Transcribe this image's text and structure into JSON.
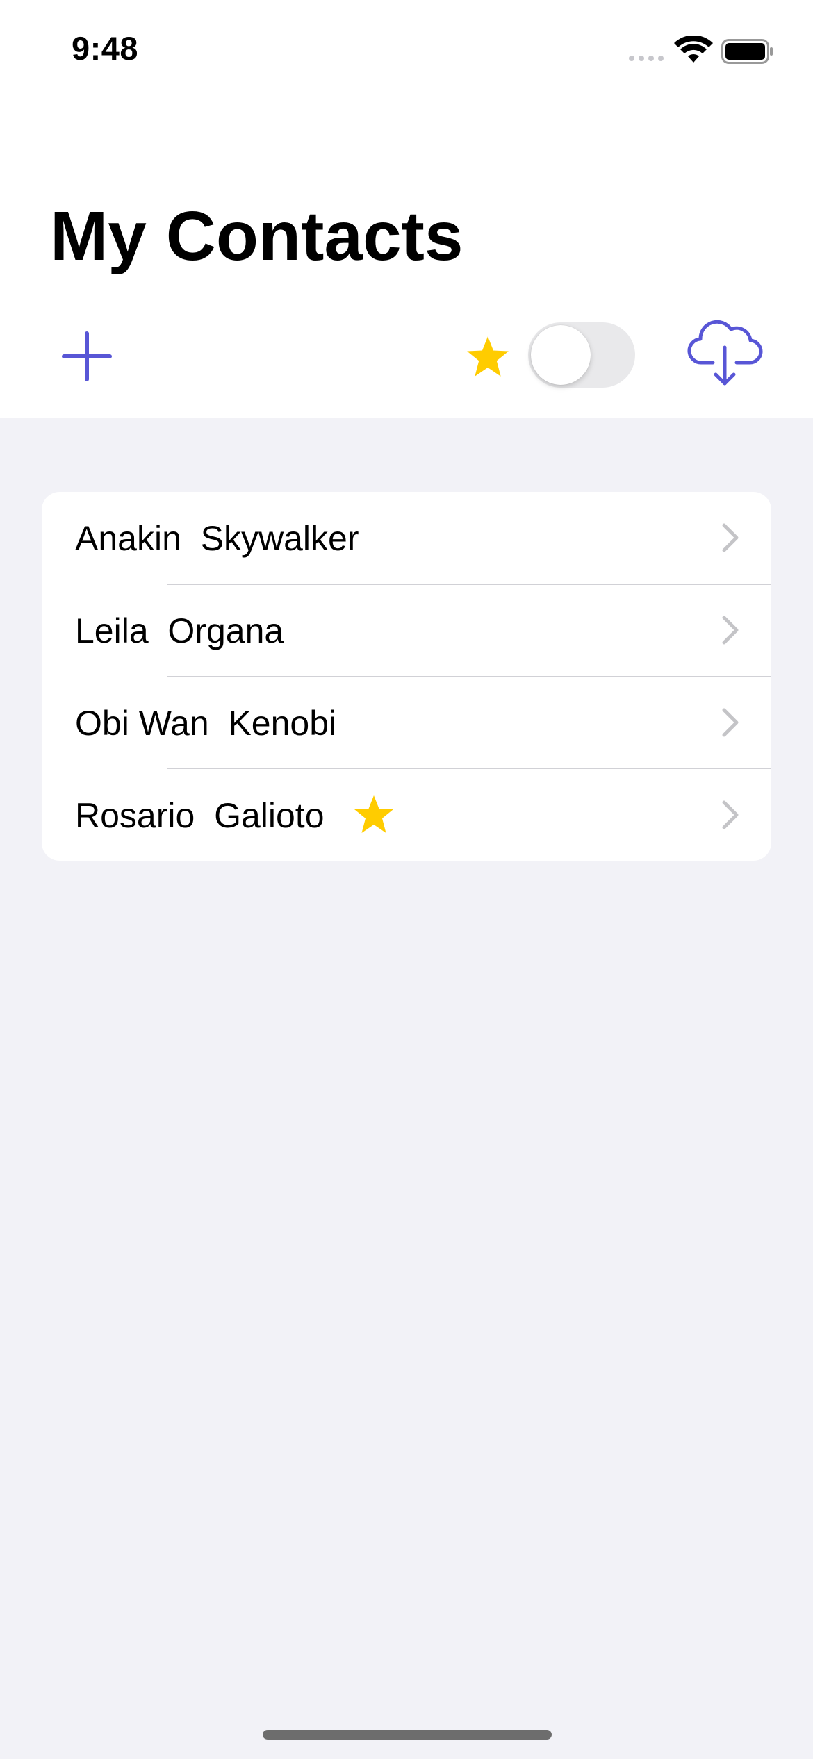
{
  "status_bar": {
    "time": "9:48",
    "icons": [
      "signal-dots-icon",
      "wifi-icon",
      "battery-icon"
    ]
  },
  "header": {
    "title": "My Contacts"
  },
  "toolbar": {
    "add_icon": "plus-icon",
    "favorites_icon": "star-icon",
    "favorites_filter_on": false,
    "cloud_icon": "cloud-download-icon"
  },
  "contacts": [
    {
      "name": "Anakin  Skywalker",
      "favorite": false
    },
    {
      "name": "Leila  Organa",
      "favorite": false
    },
    {
      "name": "Obi Wan  Kenobi",
      "favorite": false
    },
    {
      "name": "Rosario  Galioto",
      "favorite": true
    }
  ],
  "colors": {
    "accent": "#5856d6",
    "star": "#ffcc00",
    "background": "#f2f2f7",
    "chevron": "#c4c4c7"
  }
}
